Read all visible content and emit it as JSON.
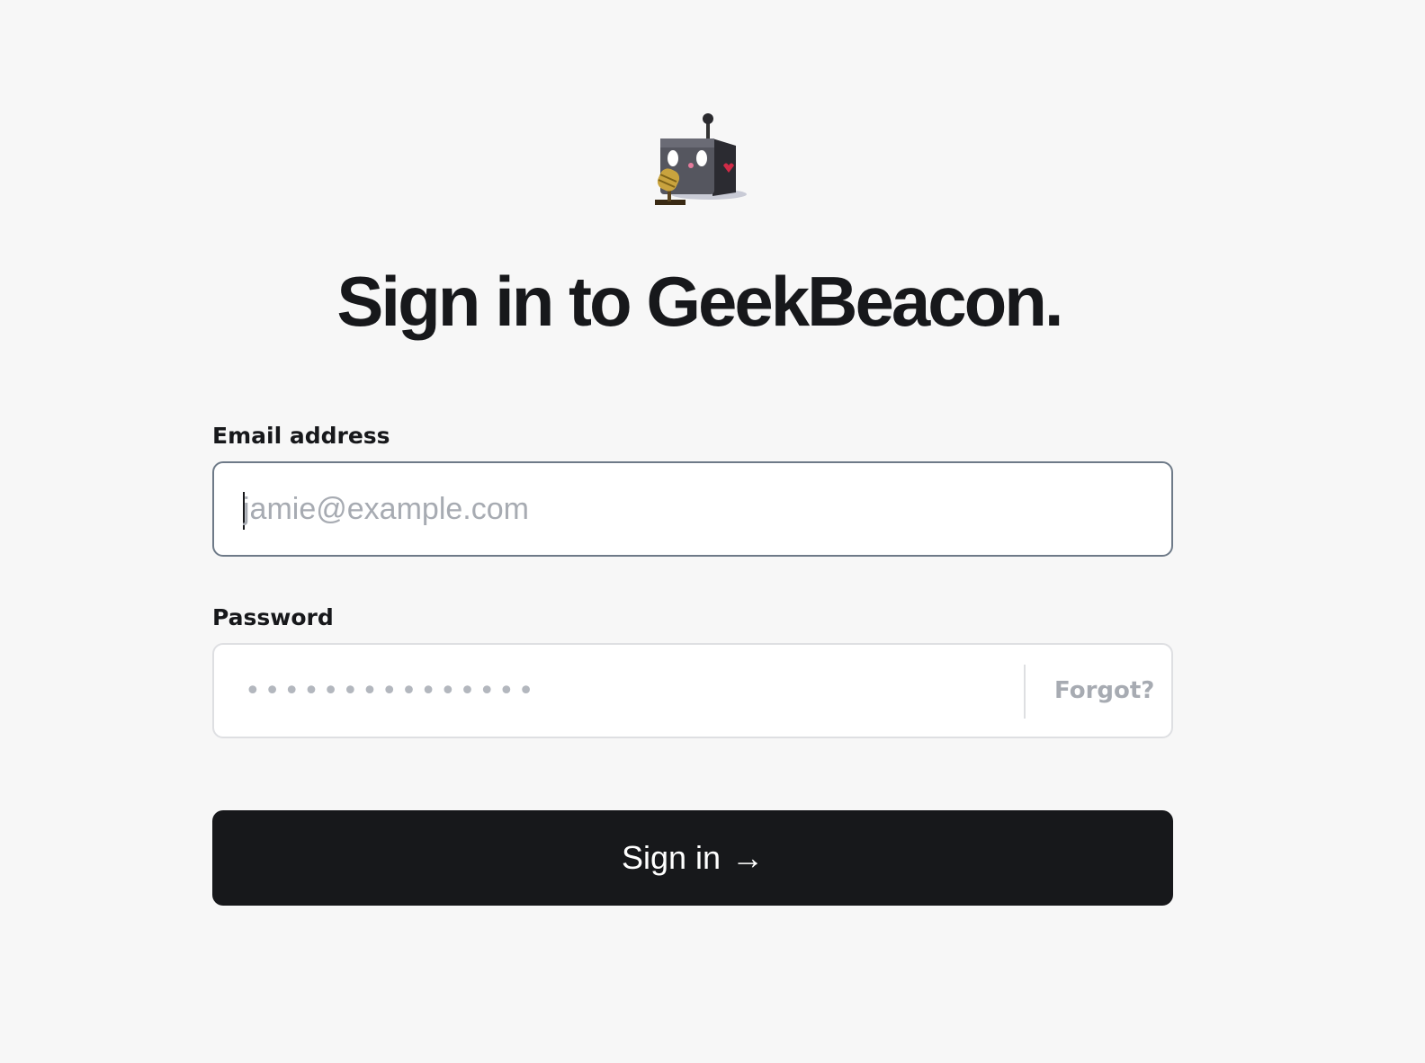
{
  "app": {
    "title": "Sign in to GeekBeacon."
  },
  "logo": {
    "icon": "robot-microphone-icon"
  },
  "form": {
    "email": {
      "label": "Email address",
      "placeholder": "jamie@example.com",
      "value": ""
    },
    "password": {
      "label": "Password",
      "masked_value": "•••••••••••••••",
      "forgot_label": "Forgot?"
    },
    "submit": {
      "label": "Sign in",
      "arrow": "→"
    }
  },
  "colors": {
    "accent": "#17181b",
    "background": "#f7f7f7",
    "placeholder": "#a7abb2",
    "focused_border": "#6e7a88"
  }
}
